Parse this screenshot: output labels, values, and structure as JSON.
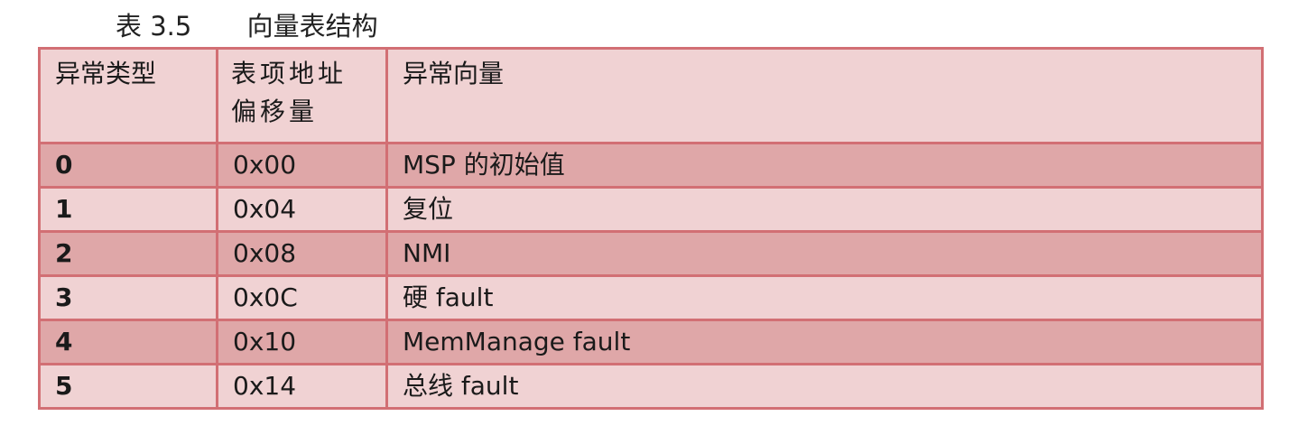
{
  "caption": {
    "label": "表 3.5",
    "title": "向量表结构"
  },
  "table": {
    "headers": [
      "异常类型",
      "表项地址偏移量",
      "异常向量"
    ],
    "rows": [
      {
        "type": "0",
        "offset": "0x00",
        "vector": "MSP 的初始值"
      },
      {
        "type": "1",
        "offset": "0x04",
        "vector": "复位"
      },
      {
        "type": "2",
        "offset": "0x08",
        "vector": "NMI"
      },
      {
        "type": "3",
        "offset": "0x0C",
        "vector": "硬 fault"
      },
      {
        "type": "4",
        "offset": "0x10",
        "vector": "MemManage fault"
      },
      {
        "type": "5",
        "offset": "0x14",
        "vector": "总线 fault"
      }
    ],
    "colors": {
      "border": "#d26f74",
      "row_dark": "#dfa7a8",
      "row_light": "#f0d2d3"
    }
  }
}
